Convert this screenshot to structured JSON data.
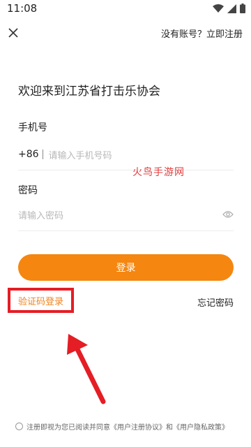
{
  "status": {
    "time": "11:08"
  },
  "header": {
    "register_prompt": "没有账号？立即注册"
  },
  "welcome": "欢迎来到江苏省打击乐协会",
  "phone": {
    "label": "手机号",
    "prefix": "+86",
    "placeholder": "请输入手机号码"
  },
  "watermark": "火鸟手游网",
  "password": {
    "label": "密码",
    "placeholder": "请输入密码"
  },
  "login_button": "登录",
  "sms_login": "验证码登录",
  "forgot_password": "忘记密码",
  "agreement": "注册即视为您已阅读并同意《用户注册协议》和《用户隐私政策》",
  "colors": {
    "accent": "#f5860f",
    "highlight": "#e51d24"
  }
}
